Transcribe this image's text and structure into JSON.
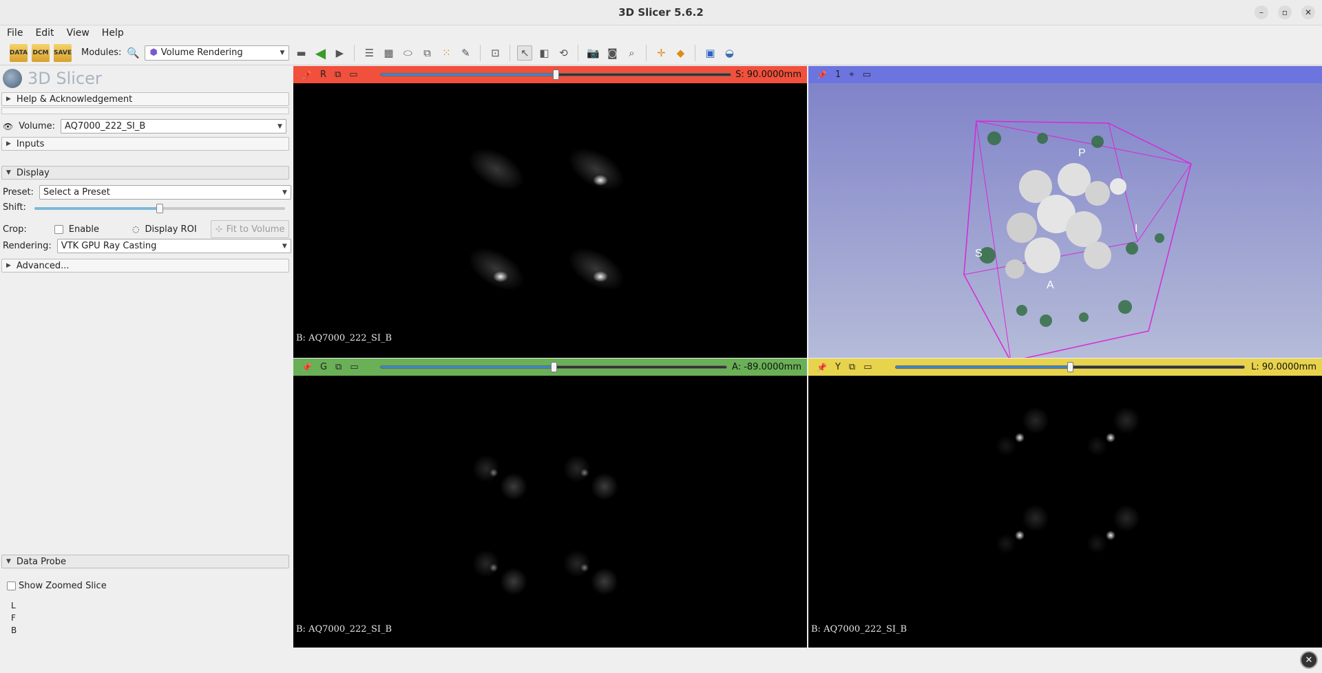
{
  "window": {
    "title": "3D Slicer 5.6.2"
  },
  "menu": [
    "File",
    "Edit",
    "View",
    "Help"
  ],
  "toolbar": {
    "data_label": "DATA",
    "dcm_label": "DCM",
    "save_label": "SAVE",
    "modules_label": "Modules:",
    "module_selected": "Volume Rendering"
  },
  "panel": {
    "logo_text": "3D Slicer",
    "help_section": "Help & Acknowledgement",
    "volume_label": "Volume:",
    "volume_value": "AQ7000_222_SI_B",
    "inputs_section": "Inputs",
    "display_section": "Display",
    "preset_label": "Preset:",
    "preset_value": "Select a Preset",
    "shift_label": "Shift:",
    "shift_level": 0.5,
    "crop_label": "Crop:",
    "enable_label": "Enable",
    "display_roi_label": "Display ROI",
    "fit_to_volume_label": "Fit to Volume",
    "rendering_label": "Rendering:",
    "rendering_value": "VTK GPU Ray Casting",
    "advanced_section": "Advanced...",
    "data_probe_section": "Data Probe",
    "show_zoomed_slice_label": "Show Zoomed Slice",
    "probe_lines": [
      "L",
      "F",
      "B"
    ]
  },
  "views": {
    "red": {
      "letter": "R",
      "value": "S: 90.0000mm",
      "color": "#f0503c",
      "volume_label": "B: AQ7000_222_SI_B",
      "slider_level": 0.5
    },
    "green": {
      "letter": "G",
      "value": "A: -89.0000mm",
      "color": "#6ab056",
      "volume_label": "B: AQ7000_222_SI_B",
      "slider_level": 0.5
    },
    "yellow": {
      "letter": "Y",
      "value": "L: 90.0000mm",
      "color": "#e8d34c",
      "volume_label": "B: AQ7000_222_SI_B",
      "slider_level": 0.5
    },
    "threed": {
      "label": "1",
      "color": "#6c74e0",
      "orientation_labels": [
        "P",
        "S",
        "I",
        "A"
      ]
    }
  },
  "colors": {
    "roi_box": "#d828d8",
    "bg_top": "#7d80c8",
    "bg_bottom": "#b5bbd8"
  }
}
